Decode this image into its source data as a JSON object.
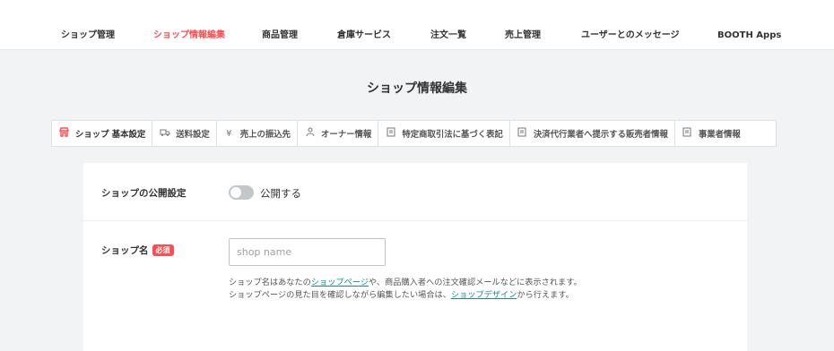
{
  "topnav": {
    "items": [
      {
        "label": "ショップ管理"
      },
      {
        "label": "ショップ情報編集"
      },
      {
        "label": "商品管理"
      },
      {
        "label": "倉庫サービス"
      },
      {
        "label": "注文一覧"
      },
      {
        "label": "売上管理"
      },
      {
        "label": "ユーザーとのメッセージ"
      },
      {
        "label": "BOOTH Apps"
      }
    ]
  },
  "page": {
    "title": "ショップ情報編集"
  },
  "tabs": [
    {
      "label": "ショップ 基本設定",
      "icon": "shop-icon"
    },
    {
      "label": "送料設定",
      "icon": "truck-icon"
    },
    {
      "label": "売上の振込先",
      "icon": "yen-icon"
    },
    {
      "label": "オーナー情報",
      "icon": "user-icon"
    },
    {
      "label": "特定商取引法に基づく表記",
      "icon": "document-icon"
    },
    {
      "label": "決済代行業者へ提示する販売者情報",
      "icon": "document-icon"
    },
    {
      "label": "事業者情報",
      "icon": "document-icon"
    }
  ],
  "form": {
    "publish": {
      "label": "ショップの公開設定",
      "toggle_label": "公開する"
    },
    "shop_name": {
      "label": "ショップ名",
      "required": "必須",
      "placeholder": "shop name",
      "help_1a": "ショップ名はあなたの",
      "help_1_link": "ショップページ",
      "help_1b": "や、商品購入者への注文確認メールなどに表示されます。",
      "help_2a": "ショップページの見た目を確認しながら編集したい場合は、",
      "help_2_link": "ショップデザイン",
      "help_2b": "から行えます。"
    }
  },
  "colors": {
    "accent": "#fc4d50",
    "link": "#1c8a95"
  }
}
